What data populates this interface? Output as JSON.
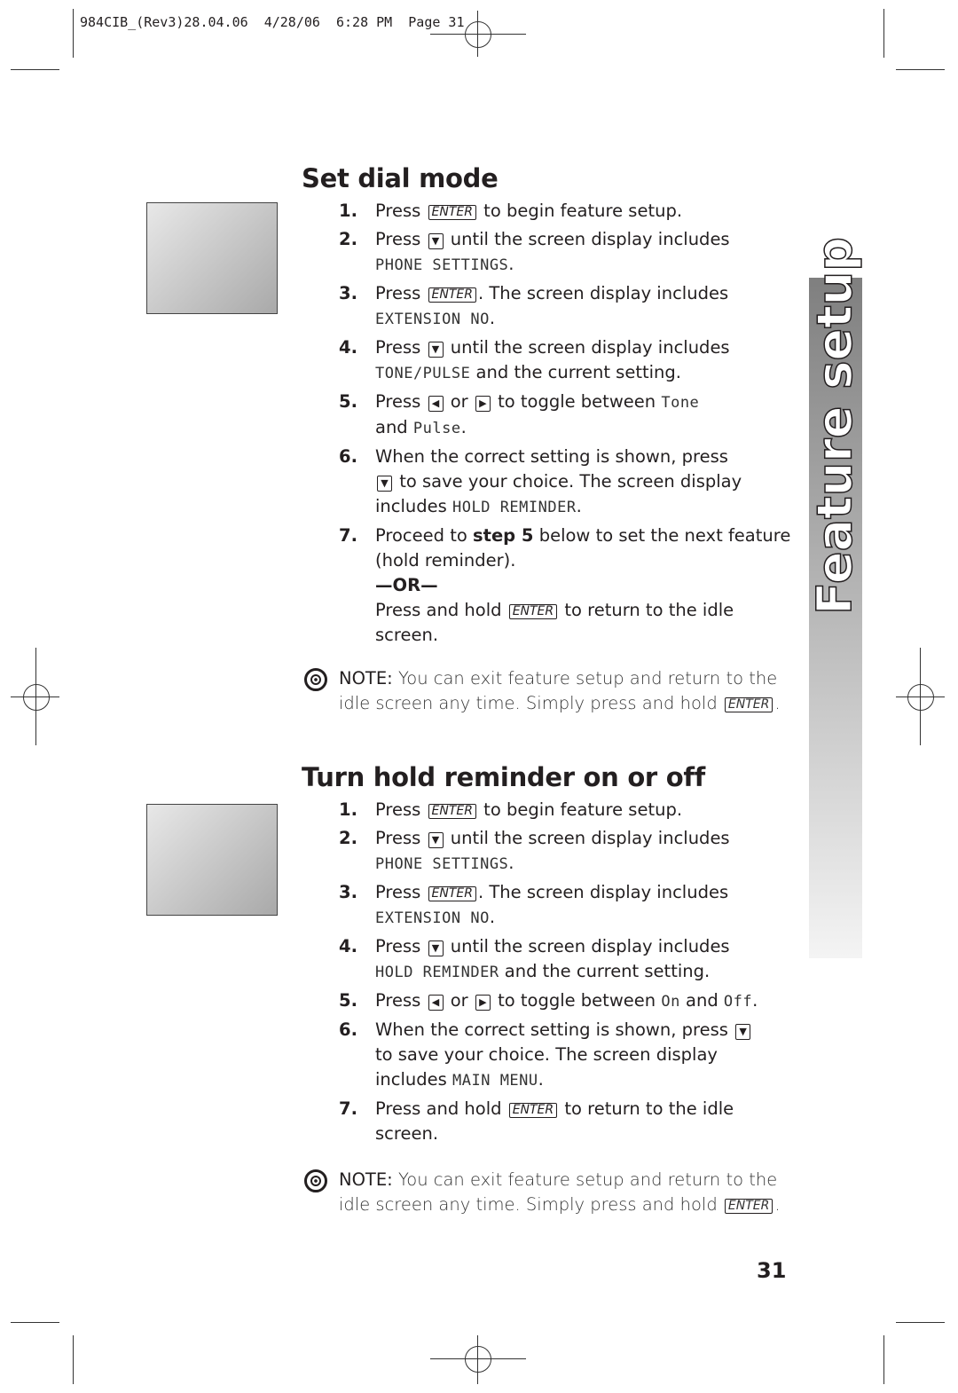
{
  "header": {
    "slug": "984CIB_(Rev3)28.04.06  4/28/06  6:28 PM  Page 31"
  },
  "side_tab": {
    "label": "Feature setup"
  },
  "page_number": "31",
  "sections": [
    {
      "title": "Set dial mode",
      "steps": [
        {
          "num": "1.",
          "seg": [
            [
              "t",
              "Press "
            ],
            [
              "k",
              "ENTER"
            ],
            [
              "t",
              " to begin feature setup."
            ]
          ]
        },
        {
          "num": "2.",
          "seg": [
            [
              "t",
              "Press "
            ],
            [
              "down",
              "▼"
            ],
            [
              "t",
              " until the screen display includes"
            ],
            [
              "br",
              ""
            ],
            [
              "l",
              "PHONE SETTINGS"
            ],
            [
              "t",
              "."
            ]
          ]
        },
        {
          "num": "3.",
          "seg": [
            [
              "t",
              "Press "
            ],
            [
              "k",
              "ENTER"
            ],
            [
              "t",
              ". The screen display includes"
            ],
            [
              "br",
              ""
            ],
            [
              "l",
              "EXTENSION NO"
            ],
            [
              "t",
              "."
            ]
          ]
        },
        {
          "num": "4.",
          "seg": [
            [
              "t",
              "Press "
            ],
            [
              "down",
              "▼"
            ],
            [
              "t",
              " until the screen display includes"
            ],
            [
              "br",
              ""
            ],
            [
              "l",
              "TONE/PULSE"
            ],
            [
              "t",
              " and the current setting."
            ]
          ]
        },
        {
          "num": "5.",
          "seg": [
            [
              "t",
              "Press "
            ],
            [
              "left",
              "◀"
            ],
            [
              "t",
              " or "
            ],
            [
              "right",
              "▶"
            ],
            [
              "t",
              " to toggle between "
            ],
            [
              "l",
              "Tone"
            ],
            [
              "br",
              ""
            ],
            [
              "t",
              "and "
            ],
            [
              "l",
              "Pulse"
            ],
            [
              "t",
              "."
            ]
          ]
        },
        {
          "num": "6.",
          "seg": [
            [
              "t",
              "When the correct setting is shown,  press"
            ],
            [
              "br",
              ""
            ],
            [
              "down",
              "▼"
            ],
            [
              "t",
              " to save your choice. The screen display"
            ],
            [
              "br",
              ""
            ],
            [
              "t",
              "includes "
            ],
            [
              "l",
              "HOLD REMINDER"
            ],
            [
              "t",
              "."
            ]
          ]
        },
        {
          "num": "7.",
          "seg": [
            [
              "t",
              "Proceed to "
            ],
            [
              "b",
              "step 5"
            ],
            [
              "t",
              " below to set the next feature"
            ],
            [
              "br",
              ""
            ],
            [
              "t",
              "(hold reminder)."
            ],
            [
              "br",
              ""
            ],
            [
              "or",
              "—OR—"
            ],
            [
              "br",
              ""
            ],
            [
              "t",
              "Press and hold "
            ],
            [
              "k",
              "ENTER"
            ],
            [
              "t",
              " to return to the idle"
            ],
            [
              "br",
              ""
            ],
            [
              "t",
              "screen."
            ]
          ]
        }
      ],
      "note": {
        "label": "NOTE:",
        "text1": " You can exit feature setup and return to the",
        "text2": "idle screen any time.  Simply press and hold ",
        "key": "ENTER",
        "end": "."
      }
    },
    {
      "title": "Turn hold reminder on or off",
      "steps": [
        {
          "num": "1.",
          "seg": [
            [
              "t",
              "Press "
            ],
            [
              "k",
              "ENTER"
            ],
            [
              "t",
              " to begin feature setup."
            ]
          ]
        },
        {
          "num": "2.",
          "seg": [
            [
              "t",
              "Press "
            ],
            [
              "down",
              "▼"
            ],
            [
              "t",
              " until the screen display includes"
            ],
            [
              "br",
              ""
            ],
            [
              "l",
              "PHONE SETTINGS"
            ],
            [
              "t",
              "."
            ]
          ]
        },
        {
          "num": "3.",
          "seg": [
            [
              "t",
              "Press "
            ],
            [
              "k",
              "ENTER"
            ],
            [
              "t",
              ". The screen display includes"
            ],
            [
              "br",
              ""
            ],
            [
              "l",
              "EXTENSION NO"
            ],
            [
              "t",
              "."
            ]
          ]
        },
        {
          "num": "4.",
          "seg": [
            [
              "t",
              "Press "
            ],
            [
              "down",
              "▼"
            ],
            [
              "t",
              " until the screen display includes"
            ],
            [
              "br",
              ""
            ],
            [
              "l",
              "HOLD REMINDER"
            ],
            [
              "t",
              " and the current setting."
            ]
          ]
        },
        {
          "num": "5.",
          "seg": [
            [
              "t",
              "Press "
            ],
            [
              "left",
              "◀"
            ],
            [
              "t",
              " or "
            ],
            [
              "right",
              "▶"
            ],
            [
              "t",
              " to toggle between "
            ],
            [
              "l",
              "On"
            ],
            [
              "t",
              " and "
            ],
            [
              "l",
              "Off"
            ],
            [
              "t",
              "."
            ]
          ]
        },
        {
          "num": "6.",
          "seg": [
            [
              "t",
              "When the correct setting is shown,  press "
            ],
            [
              "down",
              "▼"
            ],
            [
              "br",
              ""
            ],
            [
              "t",
              "to save your choice. The screen display"
            ],
            [
              "br",
              ""
            ],
            [
              "t",
              "includes "
            ],
            [
              "l",
              "MAIN MENU"
            ],
            [
              "t",
              "."
            ]
          ]
        },
        {
          "num": "7.",
          "seg": [
            [
              "t",
              "Press and hold "
            ],
            [
              "k",
              "ENTER"
            ],
            [
              "t",
              " to return to the idle"
            ],
            [
              "br",
              ""
            ],
            [
              "t",
              "screen."
            ]
          ]
        }
      ],
      "note": {
        "label": "NOTE:",
        "text1": " You can exit feature setup and return to the",
        "text2": "idle screen any time.  Simply press and hold ",
        "key": "ENTER",
        "end": "."
      }
    }
  ]
}
